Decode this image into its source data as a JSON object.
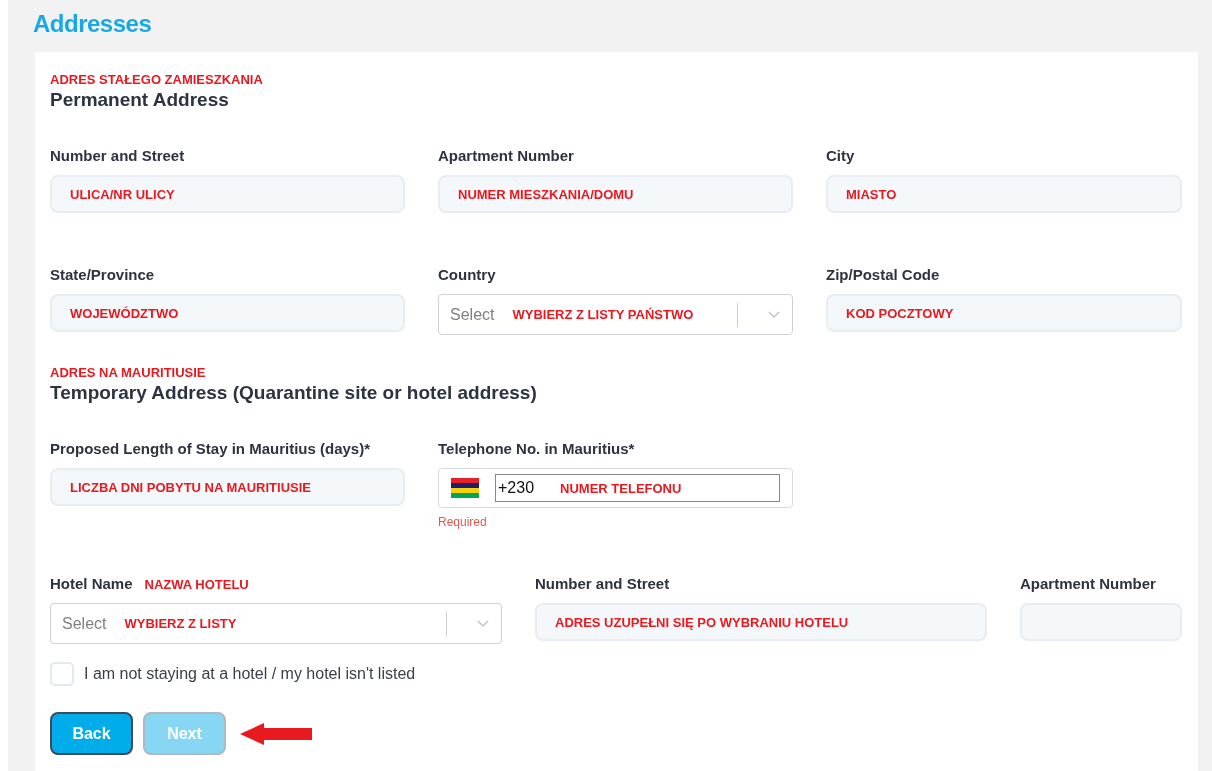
{
  "title": "Addresses",
  "permanent": {
    "annotation": "ADRES STAŁEGO ZAMIESZKANIA",
    "heading": "Permanent Address",
    "fields": [
      {
        "kind": "text",
        "label": "Number and Street",
        "annotation": "ULICA/NR ULICY"
      },
      {
        "kind": "text",
        "label": "Apartment Number",
        "annotation": "NUMER MIESZKANIA/DOMU"
      },
      {
        "kind": "text",
        "label": "City",
        "annotation": "MIASTO"
      },
      {
        "kind": "text",
        "label": "State/Province",
        "annotation": "WOJEWÓDZTWO"
      },
      {
        "kind": "select",
        "label": "Country",
        "placeholder": "Select",
        "annotation": "WYBIERZ Z LISTY PAŃSTWO"
      },
      {
        "kind": "text",
        "label": "Zip/Postal Code",
        "annotation": "KOD POCZTOWY"
      }
    ]
  },
  "temporary": {
    "annotation": "ADRES NA MAURITIUSIE",
    "heading": "Temporary Address (Quarantine site or hotel address)",
    "fields": [
      {
        "kind": "text",
        "label": "Proposed Length of Stay in Mauritius (days)*",
        "annotation": "LICZBA DNI POBYTU NA MAURITIUSIE"
      },
      {
        "kind": "phone",
        "label": "Telephone No. in Mauritius*",
        "value": "+230",
        "annotation": "NUMER TELEFONU",
        "error": "Required"
      }
    ]
  },
  "hotel": {
    "fields": [
      {
        "kind": "select",
        "label": "Hotel Name",
        "label_annotation": "NAZWA HOTELU",
        "placeholder": "Select",
        "annotation": "WYBIERZ Z LISTY"
      },
      {
        "kind": "text",
        "label": "Number and Street",
        "annotation": "ADRES UZUPEŁNI SIĘ PO WYBRANIU HOTELU"
      },
      {
        "kind": "text",
        "label": "Apartment Number"
      }
    ],
    "checkbox": {
      "label": "I am not staying at a hotel / my hotel isn't listed",
      "checked": false
    }
  },
  "buttons": [
    {
      "label": "Back",
      "disabled": false
    },
    {
      "label": "Next",
      "disabled": true
    }
  ]
}
